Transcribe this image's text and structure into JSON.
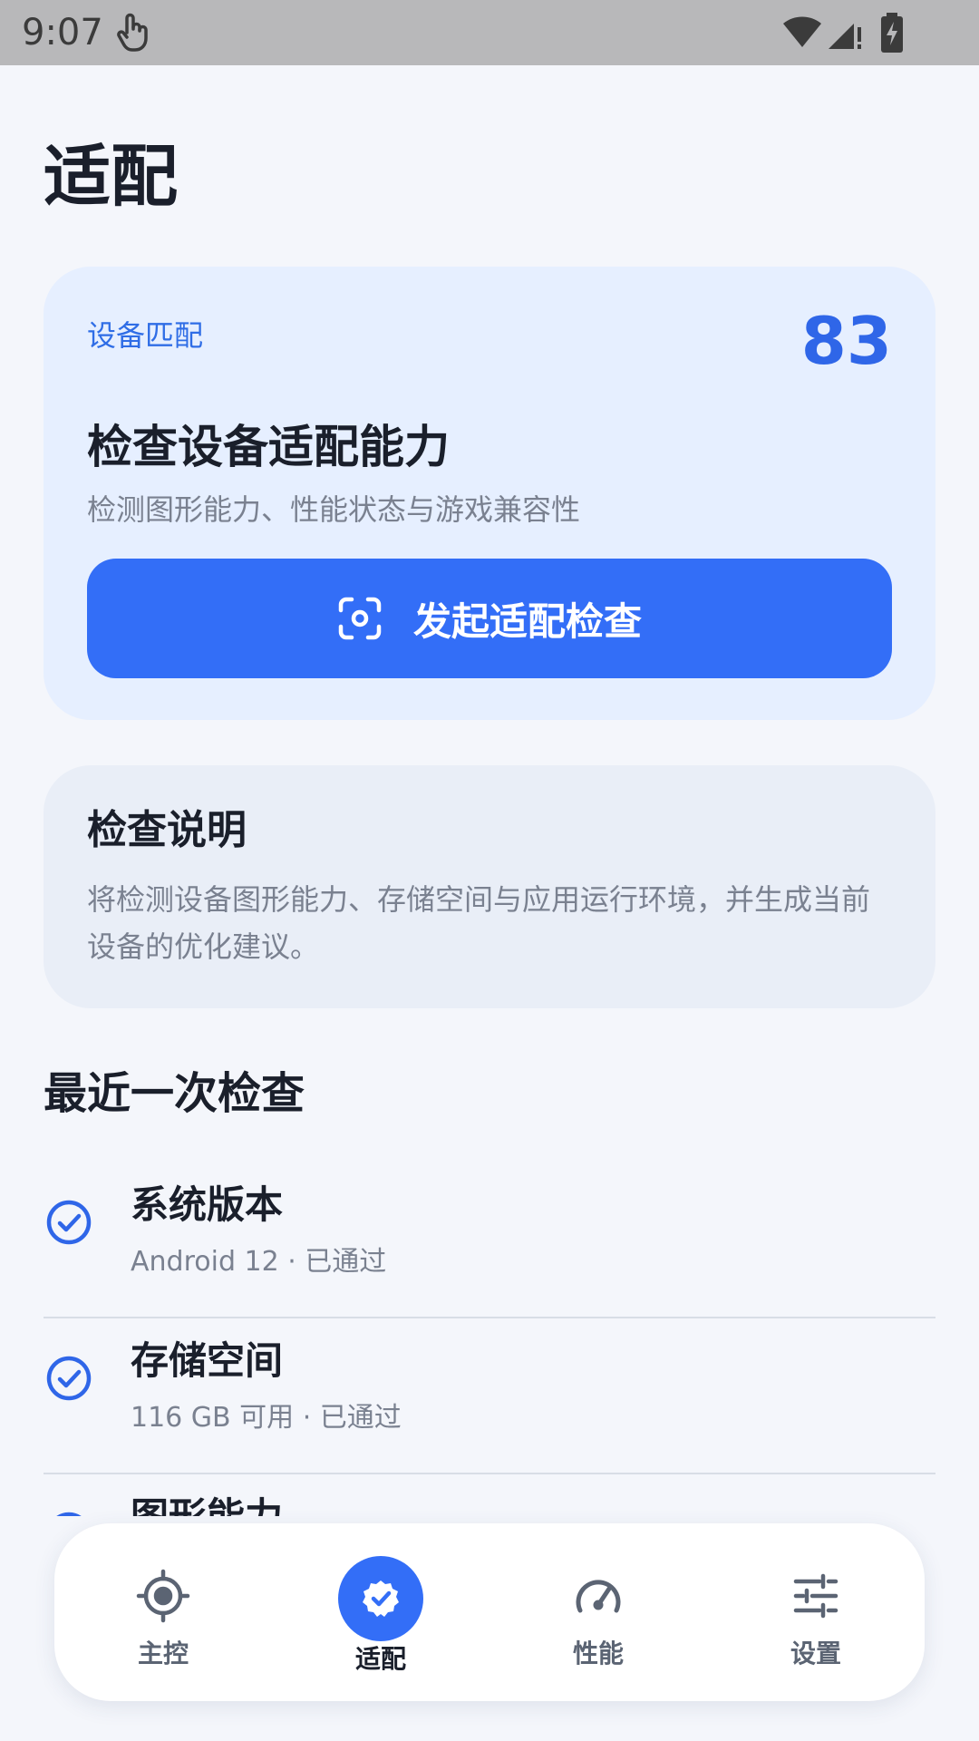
{
  "status_bar": {
    "time": "9:07"
  },
  "page": {
    "title": "适配"
  },
  "match_card": {
    "label": "设备匹配",
    "score": "83",
    "title": "检查设备适配能力",
    "subtitle": "检测图形能力、性能状态与游戏兼容性",
    "button_label": "发起适配检查"
  },
  "info_card": {
    "title": "检查说明",
    "body": "将检测设备图形能力、存储空间与应用运行环境，并生成当前设备的优化建议。"
  },
  "recent": {
    "title": "最近一次检查",
    "items": [
      {
        "title": "系统版本",
        "detail": "Android 12 · 已通过",
        "icon": "check-circle-icon"
      },
      {
        "title": "存储空间",
        "detail": "116 GB 可用 · 已通过",
        "icon": "check-circle-icon"
      },
      {
        "title": "图形能力",
        "detail": "",
        "icon": "check-circle-icon"
      }
    ]
  },
  "bottom_nav": {
    "items": [
      {
        "label": "主控",
        "icon": "target-icon",
        "active": false
      },
      {
        "label": "适配",
        "icon": "verified-badge-icon",
        "active": true
      },
      {
        "label": "性能",
        "icon": "speedometer-icon",
        "active": false
      },
      {
        "label": "设置",
        "icon": "sliders-icon",
        "active": false
      }
    ]
  },
  "colors": {
    "accent": "#336ef7",
    "card_bg": "#e6efff",
    "page_bg": "#f4f6fb"
  }
}
